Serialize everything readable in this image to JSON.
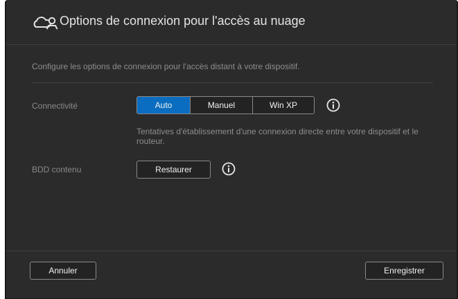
{
  "dialog": {
    "title": "Options de connexion pour l'accès au nuage",
    "title_icon": "cloud-user-icon",
    "intro": "Configure les options de connexion pour l'accès distant à votre dispositif."
  },
  "connectivity": {
    "label": "Connectivité",
    "options": [
      "Auto",
      "Manuel",
      "Win XP"
    ],
    "selected": "Auto",
    "info_icon": "info-icon",
    "description": "Tentatives d'établissement d'une connexion directe entre votre dispositif et le routeur."
  },
  "content_db": {
    "label": "BDD contenu",
    "button": "Restaurer",
    "info_icon": "info-icon"
  },
  "footer": {
    "cancel": "Annuler",
    "save": "Enregistrer"
  },
  "colors": {
    "background": "#2b2b2b",
    "accent": "#0a6dbf",
    "text": "#f2f2f2",
    "muted_text": "#8e8e8e"
  }
}
